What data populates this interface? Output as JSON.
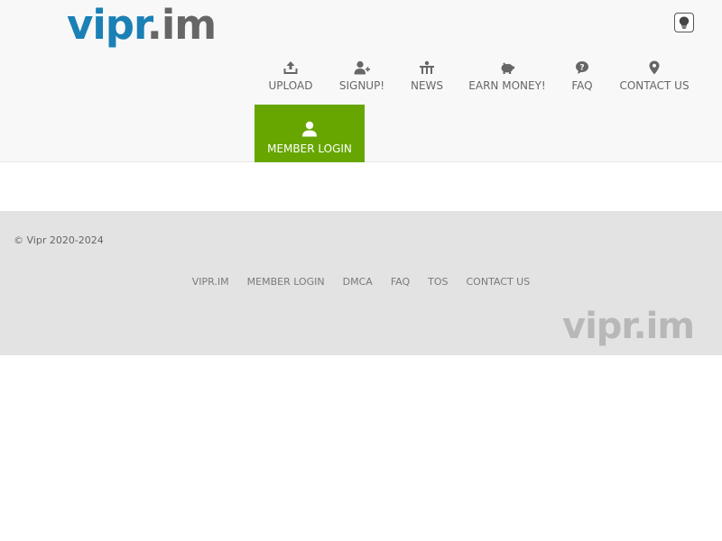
{
  "header": {
    "logo_part1": "vipr",
    "logo_part2": ".im",
    "nav": [
      {
        "label": "UPLOAD",
        "icon": "upload-icon"
      },
      {
        "label": "SIGNUP!",
        "icon": "user-plus-icon"
      },
      {
        "label": "NEWS",
        "icon": "news-icon"
      },
      {
        "label": "EARN MONEY!",
        "icon": "piggy-bank-icon"
      },
      {
        "label": "FAQ",
        "icon": "question-icon"
      },
      {
        "label": "CONTACT US",
        "icon": "map-marker-icon"
      }
    ],
    "member_login": {
      "label": "MEMBER LOGIN",
      "icon": "user-icon"
    },
    "theme_toggle_icon": "lightbulb-icon"
  },
  "footer": {
    "copyright": "© Vipr 2020-2024",
    "links": [
      "VIPR.IM",
      "MEMBER LOGIN",
      "DMCA",
      "FAQ",
      "TOS",
      "CONTACT US"
    ],
    "logo": "vipr.im"
  },
  "colors": {
    "brand_blue": "#1b80b5",
    "brand_gray": "#666666",
    "login_green": "#67a600",
    "header_bg": "#f8f8f8",
    "footer_bg": "#e3e3e3"
  }
}
